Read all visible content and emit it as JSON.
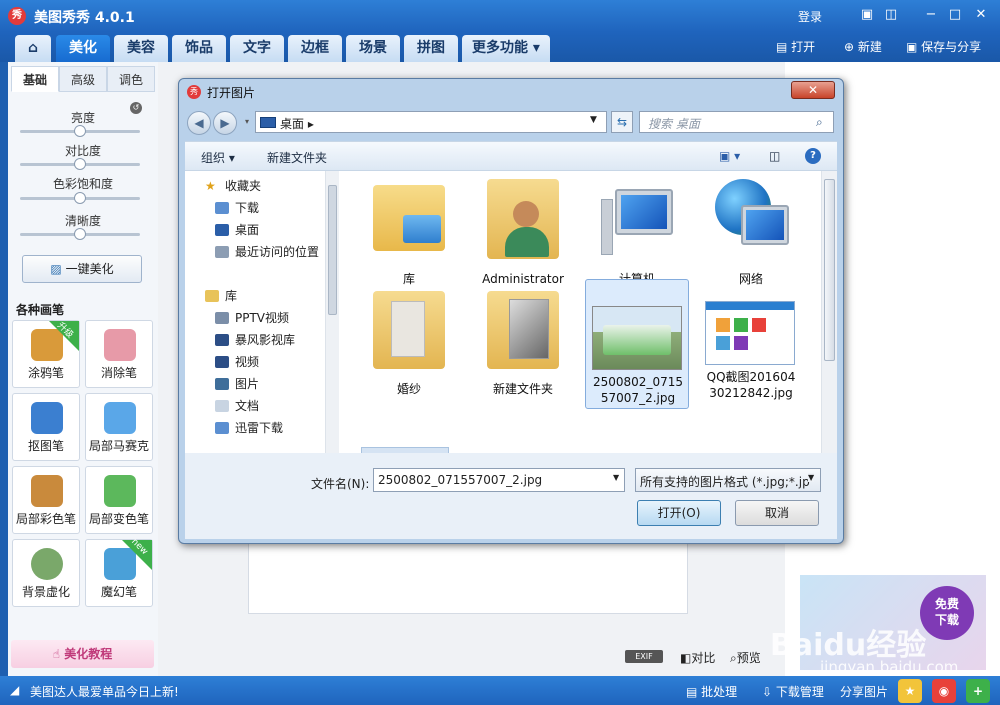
{
  "app": {
    "logo": "秀",
    "title": "美图秀秀 4.0.1",
    "login": "登录"
  },
  "window_controls": [
    "comment-icon",
    "skin-icon",
    "minimize-icon",
    "maximize-icon",
    "close-icon"
  ],
  "tabs": [
    {
      "label": "美化",
      "active": true
    },
    {
      "label": "美容",
      "active": false
    },
    {
      "label": "饰品",
      "active": false
    },
    {
      "label": "文字",
      "active": false
    },
    {
      "label": "边框",
      "active": false
    },
    {
      "label": "场景",
      "active": false
    },
    {
      "label": "拼图",
      "active": false
    },
    {
      "label": "更多功能 ▾",
      "active": false
    }
  ],
  "toolbar_right": {
    "open": "打开",
    "new": "新建",
    "save_share": "保存与分享"
  },
  "left_panel": {
    "subtabs": [
      "基础",
      "高级",
      "调色"
    ],
    "sliders": [
      {
        "label": "亮度",
        "value": 0.5
      },
      {
        "label": "对比度",
        "value": 0.5
      },
      {
        "label": "色彩饱和度",
        "value": 0.5
      },
      {
        "label": "清晰度",
        "value": 0.5
      }
    ],
    "one_key": "一键美化",
    "brushes_title": "各种画笔",
    "brushes": [
      {
        "label": "涂鸦笔",
        "badge": "升级",
        "color": "#d99a3a"
      },
      {
        "label": "消除笔",
        "badge": "",
        "color": "#e79aa8"
      },
      {
        "label": "抠图笔",
        "badge": "",
        "color": "#3b7fd0"
      },
      {
        "label": "局部马赛克",
        "badge": "",
        "color": "#5aa7e8"
      },
      {
        "label": "局部彩色笔",
        "badge": "",
        "color": "#c98a3c"
      },
      {
        "label": "局部变色笔",
        "badge": "",
        "color": "#5cb85c"
      },
      {
        "label": "背景虚化",
        "badge": "",
        "color": "#7aa86a"
      },
      {
        "label": "魔幻笔",
        "badge": "new",
        "color": "#4aa0d8"
      }
    ],
    "tutorial": "美化教程"
  },
  "main": {
    "exif": "EXIF",
    "compare": "对比",
    "preview": "预览"
  },
  "right_panel": {
    "free_download": "免费\n下载",
    "watermark": "Baidu经验",
    "watermark_url": "jingyan.baidu.com"
  },
  "status_bar": {
    "news": "美图达人最爱单品今日上新!",
    "batch": "批处理",
    "download_mgr": "下载管理",
    "share": "分享图片"
  },
  "dialog": {
    "title": "打开图片",
    "location": "桌面",
    "search_placeholder": "搜索 桌面",
    "cmd_organize": "组织 ▾",
    "cmd_new_folder": "新建文件夹",
    "nav": [
      {
        "label": "收藏夹",
        "indent": 0,
        "icon": "star-icon"
      },
      {
        "label": "下载",
        "indent": 1,
        "icon": "download-folder-icon"
      },
      {
        "label": "桌面",
        "indent": 1,
        "icon": "desktop-icon"
      },
      {
        "label": "最近访问的位置",
        "indent": 1,
        "icon": "recent-places-icon"
      },
      {
        "label": "库",
        "indent": 0,
        "icon": "library-icon"
      },
      {
        "label": "PPTV视频",
        "indent": 1,
        "icon": "video-library-icon"
      },
      {
        "label": "暴风影视库",
        "indent": 1,
        "icon": "video-library-icon"
      },
      {
        "label": "视频",
        "indent": 1,
        "icon": "video-library-icon"
      },
      {
        "label": "图片",
        "indent": 1,
        "icon": "pictures-library-icon"
      },
      {
        "label": "文档",
        "indent": 1,
        "icon": "documents-library-icon"
      },
      {
        "label": "迅雷下载",
        "indent": 1,
        "icon": "download-folder-icon"
      }
    ],
    "files": [
      {
        "label": "库",
        "icon": "library-folder-icon",
        "selected": false
      },
      {
        "label": "Administrator",
        "icon": "user-folder-icon",
        "selected": false
      },
      {
        "label": "计算机",
        "icon": "computer-icon",
        "selected": false
      },
      {
        "label": "网络",
        "icon": "network-icon",
        "selected": false
      },
      {
        "label": "婚纱",
        "icon": "folder-icon",
        "selected": false
      },
      {
        "label": "新建文件夹",
        "icon": "folder-icon",
        "selected": false
      },
      {
        "label": "2500802_071557007_2.jpg",
        "icon": "bus-photo-thumbnail",
        "selected": true
      },
      {
        "label": "QQ截图20160430212842.jpg",
        "icon": "screenshot-thumbnail",
        "selected": false
      }
    ],
    "filename_label": "文件名(N):",
    "filename_value": "2500802_071557007_2.jpg",
    "filter": "所有支持的图片格式 (*.jpg;*.jp",
    "open": "打开(O)",
    "cancel": "取消"
  }
}
